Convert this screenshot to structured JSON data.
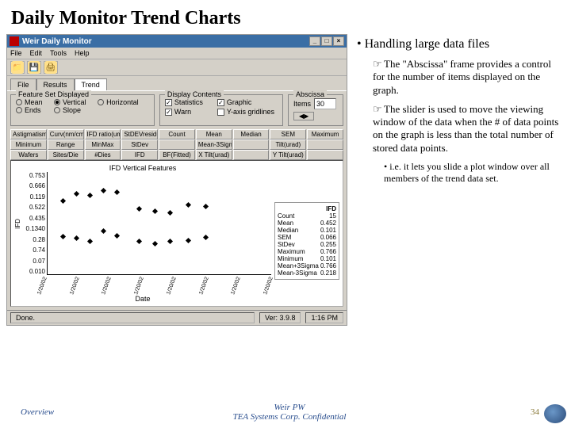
{
  "slide": {
    "title": "Daily Monitor Trend Charts"
  },
  "window": {
    "title": "Weir Daily Monitor",
    "controls": {
      "min": "_",
      "max": "□",
      "close": "×"
    }
  },
  "menu": {
    "file": "File",
    "edit": "Edit",
    "tools": "Tools",
    "help": "Help"
  },
  "toolbar_icons": {
    "open": "📁",
    "save": "💾",
    "print": "🖨"
  },
  "tabs": {
    "file": "File",
    "results": "Results",
    "trend": "Trend"
  },
  "feature_set": {
    "legend": "Feature Set Displayed",
    "mean": "Mean",
    "ends": "Ends",
    "vertical": "Vertical",
    "slope": "Slope",
    "horizontal": "Horizontal"
  },
  "display_contents": {
    "legend": "Display Contents",
    "statistics": "Statistics",
    "graphic": "Graphic",
    "warn": "Warn",
    "gridlines": "Y-axis gridlines"
  },
  "abscissa": {
    "legend": "Abscissa",
    "items_label": "Items",
    "items_value": "30",
    "slider_icon": "◀▶"
  },
  "stat_buttons": {
    "row1": [
      "Astigmatism",
      "Curv(nm/cm2)",
      "IFD ratio(um)",
      "StDEVresidual",
      "Count",
      "Mean",
      "Median",
      "SEM",
      "Maximum"
    ],
    "row2": [
      "Minimum",
      "Range",
      "MinMax",
      "StDev",
      "",
      "Mean-3Sigma",
      "",
      "Tilt(urad)",
      ""
    ],
    "row3": [
      "Wafers",
      "Sites/Die",
      "#Dies",
      "IFD",
      "BF(Fitted)",
      "X Tilt(urad)",
      "",
      "Y Tilt(urad)",
      ""
    ]
  },
  "chart_data": {
    "type": "scatter",
    "title": "IFD Vertical Features",
    "xlabel": "Date",
    "ylabel": "IFD",
    "yticks": [
      "0.753",
      "0.666",
      "0.119",
      "0.522",
      "0.435",
      "0.1340",
      "0.28",
      "0.74",
      "0.07",
      "0.010"
    ],
    "xticks": [
      "1/20/02",
      "1/20/02",
      "1/20/02",
      "1/20/02",
      "1/20/02",
      "1/20/02",
      "1/20/02",
      "1/20/02"
    ],
    "points": [
      {
        "x": 0.06,
        "y": 0.7
      },
      {
        "x": 0.12,
        "y": 0.77
      },
      {
        "x": 0.18,
        "y": 0.75
      },
      {
        "x": 0.24,
        "y": 0.8
      },
      {
        "x": 0.3,
        "y": 0.78
      },
      {
        "x": 0.4,
        "y": 0.62
      },
      {
        "x": 0.47,
        "y": 0.6
      },
      {
        "x": 0.54,
        "y": 0.58
      },
      {
        "x": 0.62,
        "y": 0.66
      },
      {
        "x": 0.7,
        "y": 0.64
      },
      {
        "x": 0.06,
        "y": 0.35
      },
      {
        "x": 0.12,
        "y": 0.33
      },
      {
        "x": 0.18,
        "y": 0.3
      },
      {
        "x": 0.24,
        "y": 0.4
      },
      {
        "x": 0.3,
        "y": 0.36
      },
      {
        "x": 0.4,
        "y": 0.3
      },
      {
        "x": 0.47,
        "y": 0.28
      },
      {
        "x": 0.54,
        "y": 0.3
      },
      {
        "x": 0.62,
        "y": 0.31
      },
      {
        "x": 0.7,
        "y": 0.34
      }
    ]
  },
  "stats_panel": {
    "header": "IFD",
    "rows": [
      {
        "k": "Count",
        "v": "15"
      },
      {
        "k": "Mean",
        "v": "0.452"
      },
      {
        "k": "Median",
        "v": "0.101"
      },
      {
        "k": "SEM",
        "v": "0.066"
      },
      {
        "k": "StDev",
        "v": "0.255"
      },
      {
        "k": "Maximum",
        "v": "0.766"
      },
      {
        "k": "Minimum",
        "v": "0.101"
      },
      {
        "k": "Mean+3Sigma",
        "v": "0.766"
      },
      {
        "k": "Mean-3Sigma",
        "v": "0.218"
      }
    ]
  },
  "status": {
    "done": "Done.",
    "ver": "Ver: 3.9.8",
    "time": "1:16 PM"
  },
  "right": {
    "heading": "Handling large data files",
    "p1": "The \"Abscissa\" frame provides a control for the number of items displayed on the graph.",
    "p2": "The slider is used to move the viewing window of the data when the # of data points on the graph is less than the total number of stored data points.",
    "p3": "i.e. it lets you slide a plot window over all members of the trend data set."
  },
  "footer": {
    "overview": "Overview",
    "center1": "Weir PW",
    "center2": "TEA Systems Corp. Confidential",
    "page": "34"
  }
}
